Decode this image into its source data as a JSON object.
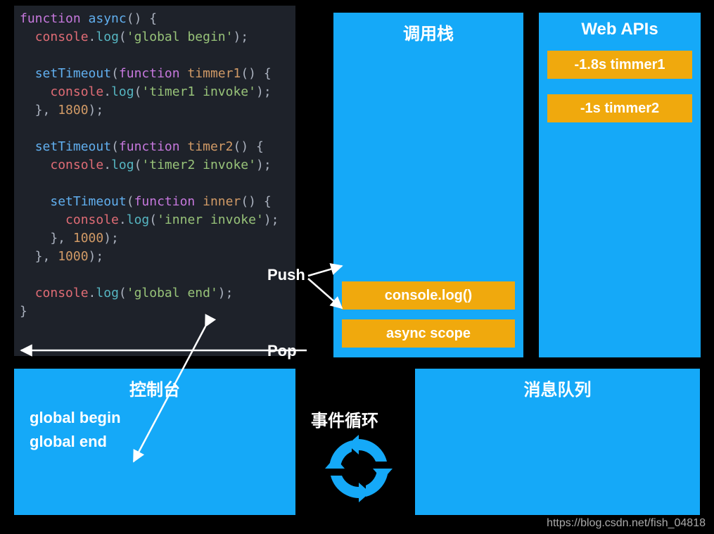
{
  "code": {
    "tokens": [
      [
        [
          "kw",
          "function"
        ],
        [
          "punc",
          " "
        ],
        [
          "fn",
          "async"
        ],
        [
          "punc",
          "() {"
        ]
      ],
      [
        [
          "punc",
          "  "
        ],
        [
          "obj",
          "console"
        ],
        [
          "punc",
          "."
        ],
        [
          "meth",
          "log"
        ],
        [
          "punc",
          "("
        ],
        [
          "str",
          "'global begin'"
        ],
        [
          "punc",
          ");"
        ]
      ],
      [],
      [
        [
          "punc",
          "  "
        ],
        [
          "fn",
          "setTimeout"
        ],
        [
          "punc",
          "("
        ],
        [
          "kw",
          "function"
        ],
        [
          "punc",
          " "
        ],
        [
          "name",
          "timmer1"
        ],
        [
          "punc",
          "() {"
        ]
      ],
      [
        [
          "punc",
          "    "
        ],
        [
          "obj",
          "console"
        ],
        [
          "punc",
          "."
        ],
        [
          "meth",
          "log"
        ],
        [
          "punc",
          "("
        ],
        [
          "str",
          "'timer1 invoke'"
        ],
        [
          "punc",
          ");"
        ]
      ],
      [
        [
          "punc",
          "  }, "
        ],
        [
          "num",
          "1800"
        ],
        [
          "punc",
          ");"
        ]
      ],
      [],
      [
        [
          "punc",
          "  "
        ],
        [
          "fn",
          "setTimeout"
        ],
        [
          "punc",
          "("
        ],
        [
          "kw",
          "function"
        ],
        [
          "punc",
          " "
        ],
        [
          "name",
          "timer2"
        ],
        [
          "punc",
          "() {"
        ]
      ],
      [
        [
          "punc",
          "    "
        ],
        [
          "obj",
          "console"
        ],
        [
          "punc",
          "."
        ],
        [
          "meth",
          "log"
        ],
        [
          "punc",
          "("
        ],
        [
          "str",
          "'timer2 invoke'"
        ],
        [
          "punc",
          ");"
        ]
      ],
      [],
      [
        [
          "punc",
          "    "
        ],
        [
          "fn",
          "setTimeout"
        ],
        [
          "punc",
          "("
        ],
        [
          "kw",
          "function"
        ],
        [
          "punc",
          " "
        ],
        [
          "name",
          "inner"
        ],
        [
          "punc",
          "() {"
        ]
      ],
      [
        [
          "punc",
          "      "
        ],
        [
          "obj",
          "console"
        ],
        [
          "punc",
          "."
        ],
        [
          "meth",
          "log"
        ],
        [
          "punc",
          "("
        ],
        [
          "str",
          "'inner invoke'"
        ],
        [
          "punc",
          ");"
        ]
      ],
      [
        [
          "punc",
          "    }, "
        ],
        [
          "num",
          "1000"
        ],
        [
          "punc",
          ");"
        ]
      ],
      [
        [
          "punc",
          "  }, "
        ],
        [
          "num",
          "1000"
        ],
        [
          "punc",
          ");"
        ]
      ],
      [],
      [
        [
          "punc",
          "  "
        ],
        [
          "obj",
          "console"
        ],
        [
          "punc",
          "."
        ],
        [
          "meth",
          "log"
        ],
        [
          "punc",
          "("
        ],
        [
          "str",
          "'global end'"
        ],
        [
          "punc",
          ");"
        ]
      ],
      [
        [
          "punc",
          "}"
        ]
      ]
    ]
  },
  "callstack": {
    "title": "调用栈",
    "frames": [
      "console.log()",
      "async scope"
    ]
  },
  "webapis": {
    "title": "Web APIs",
    "timers": [
      "-1.8s timmer1",
      "-1s timmer2"
    ]
  },
  "console": {
    "title": "控制台",
    "lines": [
      "global begin",
      "global end"
    ]
  },
  "queue": {
    "title": "消息队列"
  },
  "labels": {
    "push": "Push",
    "pop": "Pop",
    "event_loop": "事件循环"
  },
  "watermark": "https://blog.csdn.net/fish_04818",
  "colors": {
    "panel": "#15a9f8",
    "frame": "#f0a90d",
    "code_bg": "#1e222a"
  }
}
